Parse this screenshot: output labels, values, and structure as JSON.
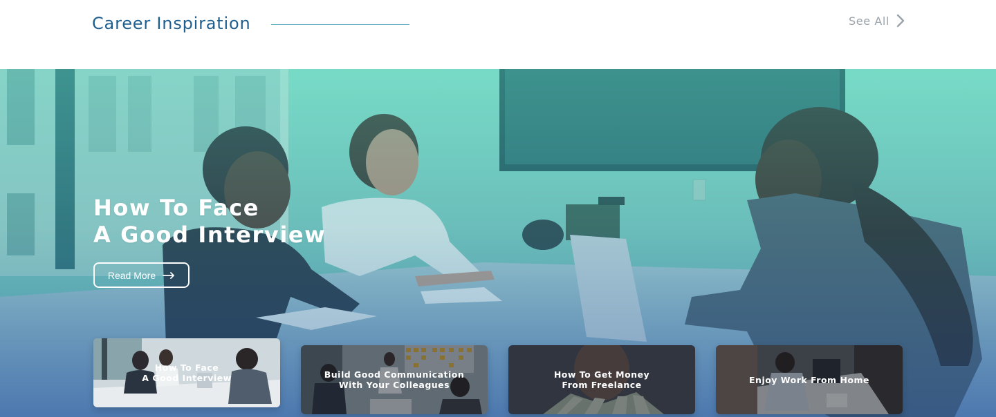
{
  "header": {
    "section_title": "Career Inspiration",
    "see_all_label": "See All"
  },
  "hero": {
    "title_line1": "How To Face",
    "title_line2": "A Good Interview",
    "read_more_label": "Read More"
  },
  "cards": [
    {
      "title": "How To Face\nA Good Interview"
    },
    {
      "title": "Build Good Communication\nWith Your Colleagues"
    },
    {
      "title": "How To Get Money\nFrom Freelance"
    },
    {
      "title": "Enjoy Work From Home"
    }
  ],
  "colors": {
    "title_blue": "#1f5f8f",
    "see_all_gray": "#9aa3aa",
    "hero_teal": "#5cdec4",
    "hero_blue": "#23569e"
  },
  "icons": {
    "see_all": "chevron-right-icon",
    "read_more": "arrow-right-icon"
  }
}
